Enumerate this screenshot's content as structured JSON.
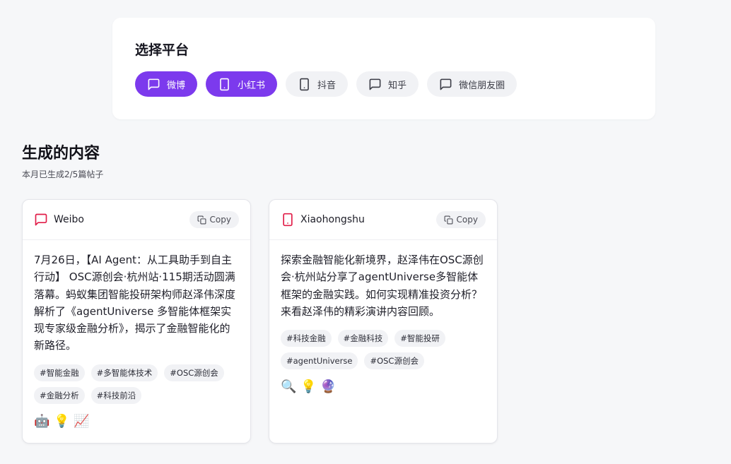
{
  "platform_selector": {
    "title": "选择平台",
    "platforms": [
      {
        "label": "微博",
        "icon": "message-square-icon",
        "active": true
      },
      {
        "label": "小红书",
        "icon": "smartphone-icon",
        "active": true
      },
      {
        "label": "抖音",
        "icon": "smartphone-icon",
        "active": false
      },
      {
        "label": "知乎",
        "icon": "message-square-icon",
        "active": false
      },
      {
        "label": "微信朋友圈",
        "icon": "message-square-icon",
        "active": false
      }
    ]
  },
  "generated": {
    "title": "生成的内容",
    "subtitle": "本月已生成2/5篇帖子"
  },
  "posts": [
    {
      "platform": "Weibo",
      "icon": "message-square-icon",
      "icon_color": "#e11d48",
      "copy_label": "Copy",
      "content": "7月26日，【AI Agent：从工具助手到自主行动】 OSC源创会·杭州站·115期活动圆满落幕。蚂蚁集团智能投研架构师赵泽伟深度解析了《agentUniverse 多智能体框架实现专家级金融分析》，揭示了金融智能化的新路径。",
      "tags": [
        "#智能金融",
        "#多智能体技术",
        "#OSC源创会",
        "#金融分析",
        "#科技前沿"
      ],
      "emojis": [
        "🤖",
        "💡",
        "📈"
      ]
    },
    {
      "platform": "Xiaohongshu",
      "icon": "smartphone-icon",
      "icon_color": "#e11d48",
      "copy_label": "Copy",
      "content": "探索金融智能化新境界，赵泽伟在OSC源创会·杭州站分享了agentUniverse多智能体框架的金融实践。如何实现精准投资分析？来看赵泽伟的精彩演讲内容回顾。",
      "tags": [
        "#科技金融",
        "#金融科技",
        "#智能投研",
        "#agentUniverse",
        "#OSC源创会"
      ],
      "emojis": [
        "🔍",
        "💡",
        "🔮"
      ]
    }
  ]
}
